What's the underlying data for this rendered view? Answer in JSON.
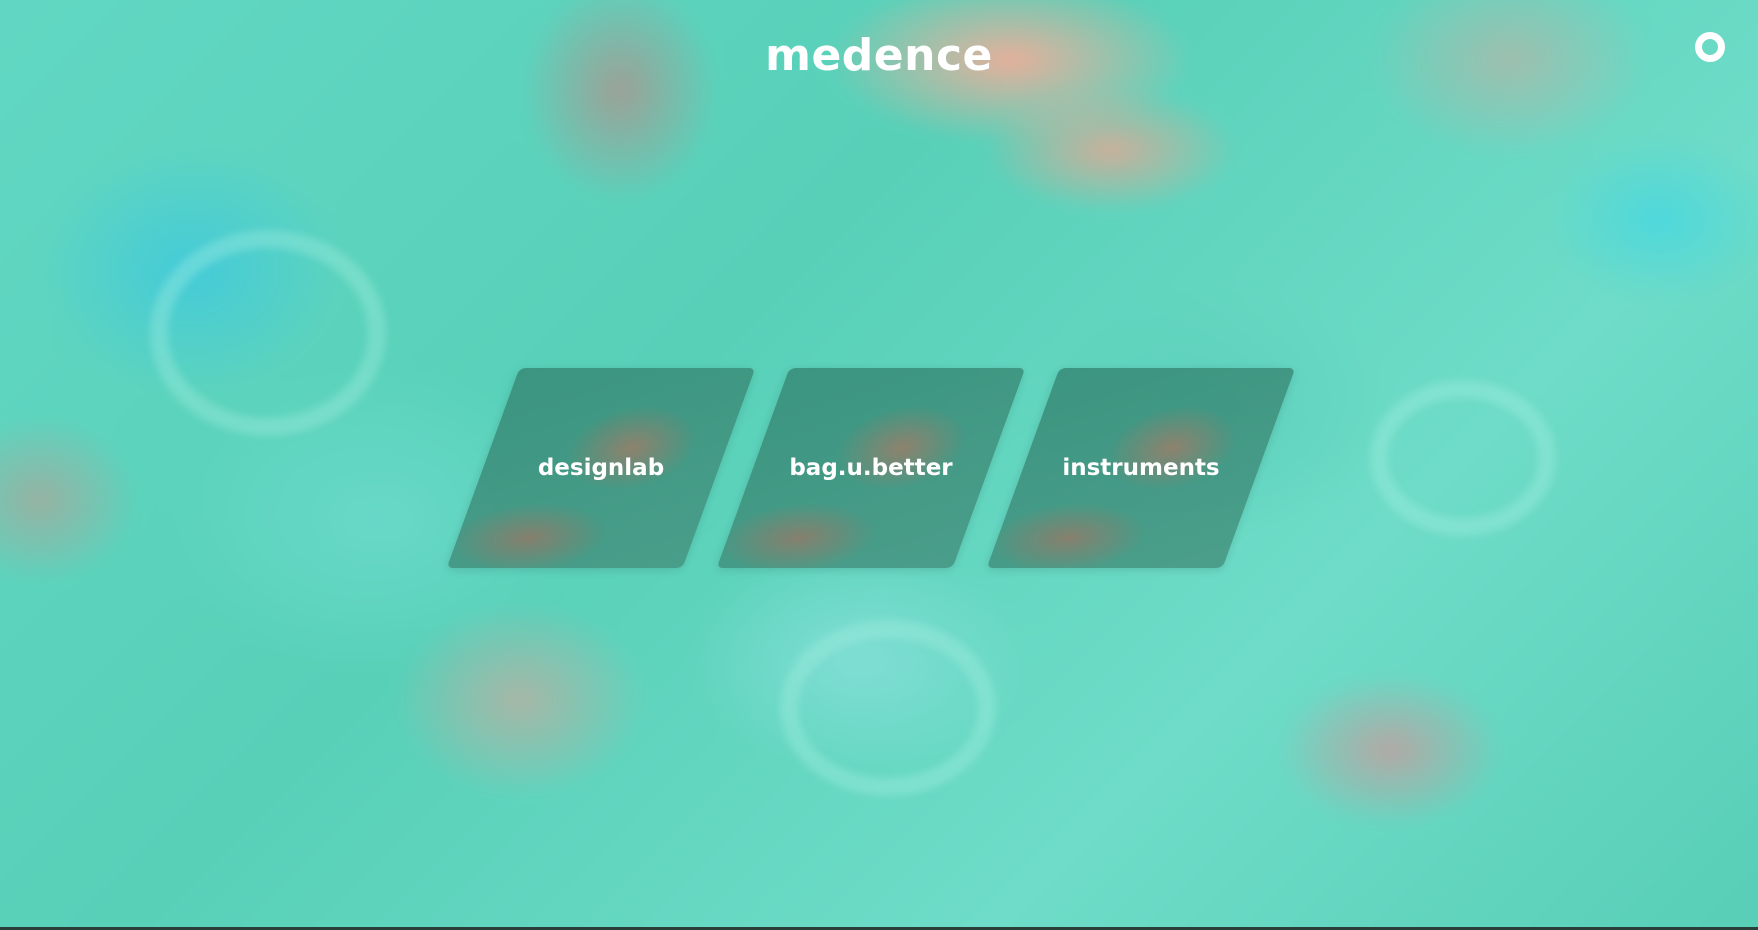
{
  "header": {
    "logo_text": "medence"
  },
  "menu": {
    "icon": "ring-icon"
  },
  "tiles": [
    {
      "label": "designlab"
    },
    {
      "label": "bag.u.better"
    },
    {
      "label": "instruments"
    }
  ],
  "colors": {
    "background_base": "#5fd6bd",
    "tile_fill": "#3b8c78",
    "text": "#ffffff"
  }
}
